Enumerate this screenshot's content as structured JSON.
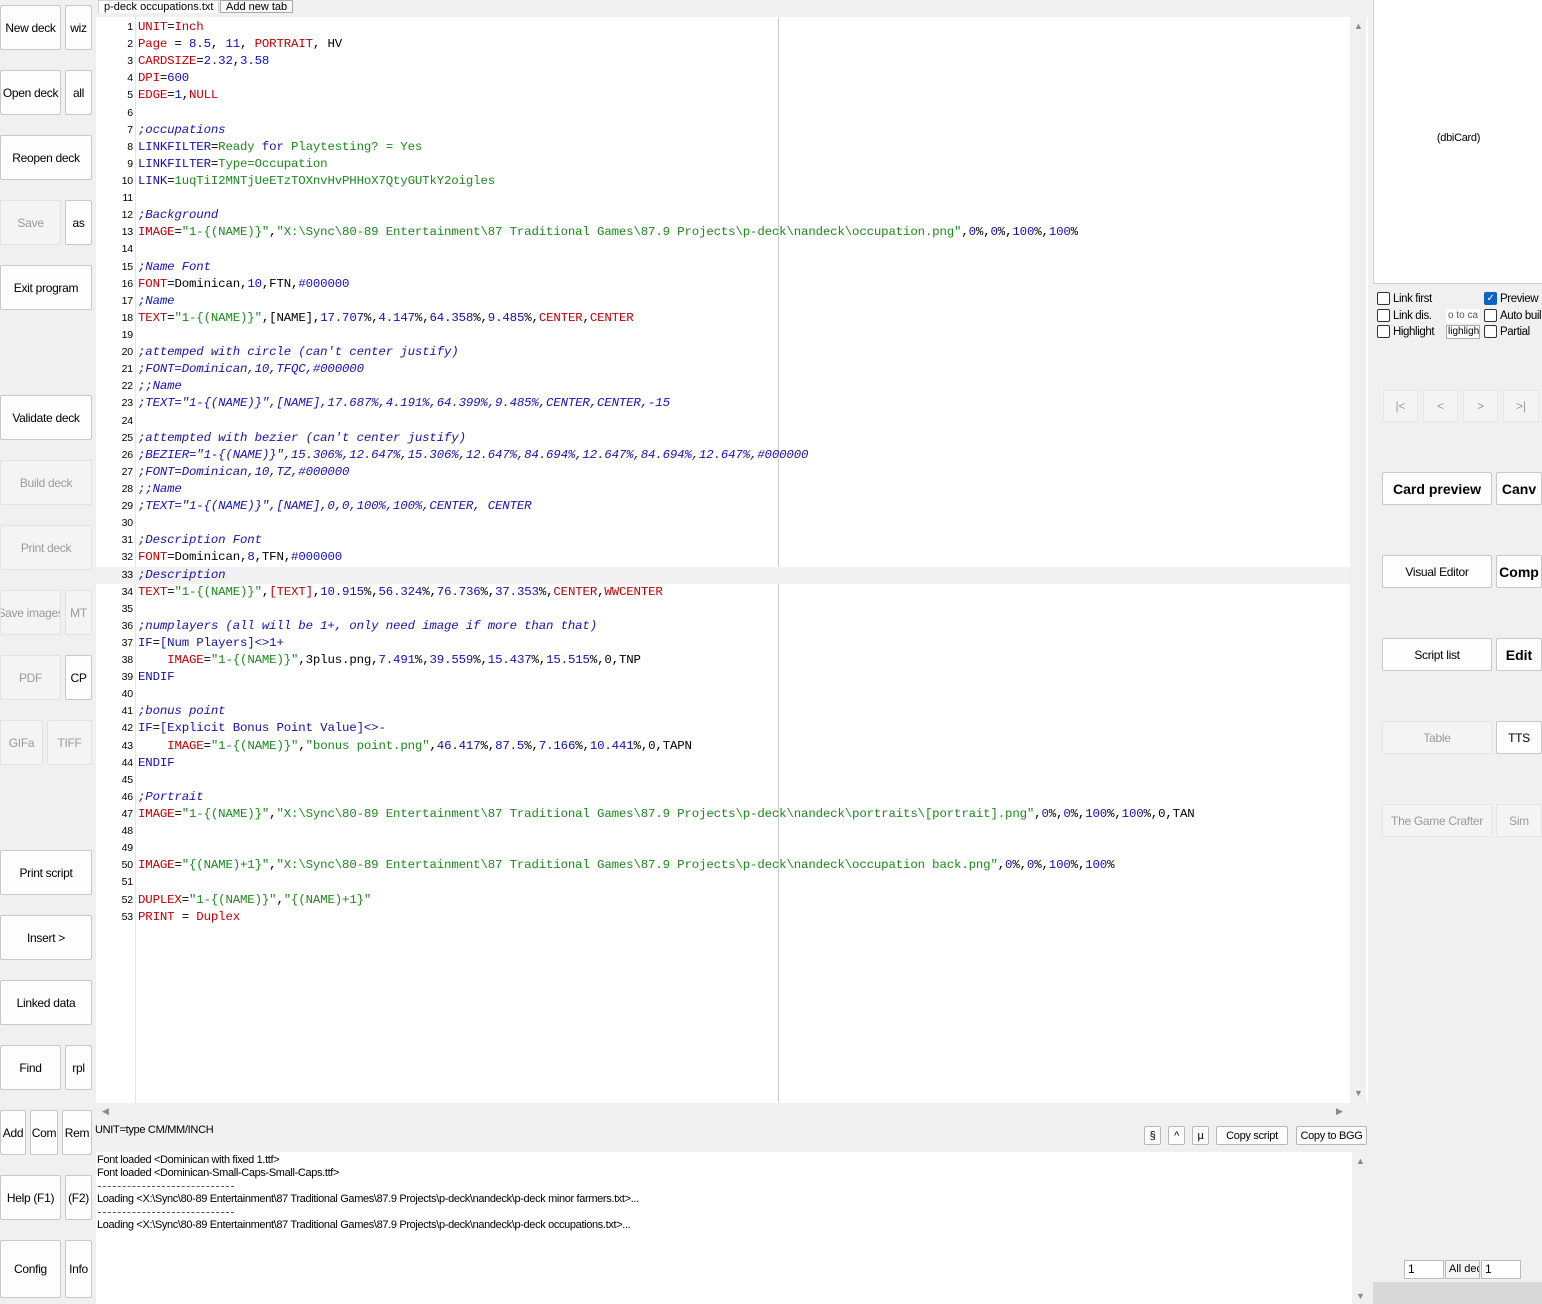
{
  "left_buttons": {
    "new_deck": "New deck",
    "wiz": "wiz",
    "open_deck": "Open deck",
    "all": "all",
    "reopen_deck": "Reopen deck",
    "save": "Save",
    "as": "as",
    "exit_program": "Exit program",
    "validate_deck": "Validate deck",
    "build_deck": "Build deck",
    "print_deck": "Print deck",
    "save_images": "Save images",
    "mt": "MT",
    "pdf": "PDF",
    "cp": "CP",
    "gifa": "GIFa",
    "tiff": "TIFF",
    "print_script": "Print script",
    "insert": "Insert >",
    "linked_data": "Linked data",
    "find": "Find",
    "rpl": "rpl",
    "add": "Add",
    "com": "Com",
    "rem": "Rem",
    "help": "Help (F1)",
    "f2": "(F2)",
    "config": "Config",
    "info": "Info"
  },
  "tabs": {
    "active": "p-deck occupations.txt",
    "add": "Add new tab"
  },
  "editor_lines": [
    [
      [
        "kw",
        "UNIT"
      ],
      [
        "ax",
        "="
      ],
      [
        "kw",
        "Inch"
      ]
    ],
    [
      [
        "kw",
        "Page"
      ],
      [
        "ax",
        " = "
      ],
      [
        "nm",
        "8.5"
      ],
      [
        "ax",
        ", "
      ],
      [
        "nm",
        "11"
      ],
      [
        "ax",
        ", "
      ],
      [
        "kw",
        "PORTRAIT"
      ],
      [
        "ax",
        ", HV"
      ]
    ],
    [
      [
        "kw",
        "CARDSIZE"
      ],
      [
        "ax",
        "="
      ],
      [
        "nm",
        "2.32"
      ],
      [
        "ax",
        ","
      ],
      [
        "nm",
        "3.58"
      ]
    ],
    [
      [
        "kw",
        "DPI"
      ],
      [
        "ax",
        "="
      ],
      [
        "nm",
        "600"
      ]
    ],
    [
      [
        "kw",
        "EDGE"
      ],
      [
        "ax",
        "="
      ],
      [
        "nm",
        "1"
      ],
      [
        "ax",
        ","
      ],
      [
        "kw",
        "NULL"
      ]
    ],
    [],
    [
      [
        "cm",
        ";occupations"
      ]
    ],
    [
      [
        "cd",
        "LINKFILTER"
      ],
      [
        "ax",
        "="
      ],
      [
        "st",
        "Ready "
      ],
      [
        "cd",
        "for"
      ],
      [
        "st",
        " Playtesting? = Yes"
      ]
    ],
    [
      [
        "cd",
        "LINKFILTER"
      ],
      [
        "ax",
        "="
      ],
      [
        "st",
        "Type=Occupation"
      ]
    ],
    [
      [
        "cd",
        "LINK"
      ],
      [
        "ax",
        "="
      ],
      [
        "st",
        "1uqTiI2MNTjUeETzTOXnvHvPHHoX7QtyGUTkY2oigles"
      ]
    ],
    [],
    [
      [
        "cm",
        ";Background"
      ]
    ],
    [
      [
        "kw",
        "IMAGE"
      ],
      [
        "ax",
        "="
      ],
      [
        "st",
        "\"1-{(NAME)}\""
      ],
      [
        "ax",
        ","
      ],
      [
        "st",
        "\"X:\\Sync\\80-89 Entertainment\\87 Traditional Games\\87.9 Projects\\p-deck\\nandeck\\occupation.png\""
      ],
      [
        "ax",
        ","
      ],
      [
        "nm",
        "0"
      ],
      [
        "ax",
        "%,"
      ],
      [
        "nm",
        "0"
      ],
      [
        "ax",
        "%,"
      ],
      [
        "nm",
        "100"
      ],
      [
        "ax",
        "%,"
      ],
      [
        "nm",
        "100"
      ],
      [
        "ax",
        "%"
      ]
    ],
    [],
    [
      [
        "cm",
        ";Name Font"
      ]
    ],
    [
      [
        "kw",
        "FONT"
      ],
      [
        "ax",
        "=Dominican,"
      ],
      [
        "nm",
        "10"
      ],
      [
        "ax",
        ",FTN,"
      ],
      [
        "nm",
        "#000000"
      ]
    ],
    [
      [
        "cm",
        ";Name"
      ]
    ],
    [
      [
        "kw",
        "TEXT"
      ],
      [
        "ax",
        "="
      ],
      [
        "st",
        "\"1-{(NAME)}\""
      ],
      [
        "ax",
        ",[NAME],"
      ],
      [
        "nm",
        "17.707"
      ],
      [
        "ax",
        "%,"
      ],
      [
        "nm",
        "4.147"
      ],
      [
        "ax",
        "%,"
      ],
      [
        "nm",
        "64.358"
      ],
      [
        "ax",
        "%,"
      ],
      [
        "nm",
        "9.485"
      ],
      [
        "ax",
        "%,"
      ],
      [
        "kw",
        "CENTER"
      ],
      [
        "ax",
        ","
      ],
      [
        "kw",
        "CENTER"
      ]
    ],
    [],
    [
      [
        "cm",
        ";attemped with circle (can't center justify)"
      ]
    ],
    [
      [
        "cm",
        ";FONT=Dominican,10,TFQC,#000000"
      ]
    ],
    [
      [
        "cm",
        ";;Name"
      ]
    ],
    [
      [
        "cm",
        ";TEXT=\"1-{(NAME)}\",[NAME],17.687%,4.191%,64.399%,9.485%,CENTER,CENTER,-15"
      ]
    ],
    [],
    [
      [
        "cm",
        ";attempted with bezier (can't center justify)"
      ]
    ],
    [
      [
        "cm",
        ";BEZIER=\"1-{(NAME)}\",15.306%,12.647%,15.306%,12.647%,84.694%,12.647%,84.694%,12.647%,#000000"
      ]
    ],
    [
      [
        "cm",
        ";FONT=Dominican,10,TZ,#000000"
      ]
    ],
    [
      [
        "cm",
        ";;Name"
      ]
    ],
    [
      [
        "cm",
        ";TEXT=\"1-{(NAME)}\",[NAME],0,0,100%,100%,CENTER, CENTER"
      ]
    ],
    [],
    [
      [
        "cm",
        ";Description Font"
      ]
    ],
    [
      [
        "kw",
        "FONT"
      ],
      [
        "ax",
        "=Dominican,"
      ],
      [
        "nm",
        "8"
      ],
      [
        "ax",
        ",TFN,"
      ],
      [
        "nm",
        "#000000"
      ]
    ],
    [
      [
        "cm",
        ";Description"
      ]
    ],
    [
      [
        "kw",
        "TEXT"
      ],
      [
        "ax",
        "="
      ],
      [
        "st",
        "\"1-{(NAME)}\""
      ],
      [
        "ax",
        ","
      ],
      [
        "kw",
        "[TEXT]"
      ],
      [
        "ax",
        ","
      ],
      [
        "nm",
        "10.915"
      ],
      [
        "ax",
        "%,"
      ],
      [
        "nm",
        "56.324"
      ],
      [
        "ax",
        "%,"
      ],
      [
        "nm",
        "76.736"
      ],
      [
        "ax",
        "%,"
      ],
      [
        "nm",
        "37.353"
      ],
      [
        "ax",
        "%,"
      ],
      [
        "kw",
        "CENTER"
      ],
      [
        "ax",
        ","
      ],
      [
        "kw",
        "WWCENTER"
      ]
    ],
    [],
    [
      [
        "cm",
        ";numplayers (all will be 1+, only need image if more than that)"
      ]
    ],
    [
      [
        "cd",
        "IF"
      ],
      [
        "ax",
        "="
      ],
      [
        "cd",
        "[Num Players]<>1+"
      ]
    ],
    [
      [
        "ax",
        "    "
      ],
      [
        "kw",
        "IMAGE"
      ],
      [
        "ax",
        "="
      ],
      [
        "st",
        "\"1-{(NAME)}\""
      ],
      [
        "ax",
        ",3plus.png,"
      ],
      [
        "nm",
        "7.491"
      ],
      [
        "ax",
        "%,"
      ],
      [
        "nm",
        "39.559"
      ],
      [
        "ax",
        "%,"
      ],
      [
        "nm",
        "15.437"
      ],
      [
        "ax",
        "%,"
      ],
      [
        "nm",
        "15.515"
      ],
      [
        "ax",
        "%,0,TNP"
      ]
    ],
    [
      [
        "cd",
        "ENDIF"
      ]
    ],
    [],
    [
      [
        "cm",
        ";bonus point"
      ]
    ],
    [
      [
        "cd",
        "IF"
      ],
      [
        "ax",
        "="
      ],
      [
        "cd",
        "[Explicit Bonus Point Value]<>-"
      ]
    ],
    [
      [
        "ax",
        "    "
      ],
      [
        "kw",
        "IMAGE"
      ],
      [
        "ax",
        "="
      ],
      [
        "st",
        "\"1-{(NAME)}\""
      ],
      [
        "ax",
        ","
      ],
      [
        "st",
        "\"bonus point.png\""
      ],
      [
        "ax",
        ","
      ],
      [
        "nm",
        "46.417"
      ],
      [
        "ax",
        "%,"
      ],
      [
        "nm",
        "87.5"
      ],
      [
        "ax",
        "%,"
      ],
      [
        "nm",
        "7.166"
      ],
      [
        "ax",
        "%,"
      ],
      [
        "nm",
        "10.441"
      ],
      [
        "ax",
        "%,0,TAPN"
      ]
    ],
    [
      [
        "cd",
        "ENDIF"
      ]
    ],
    [],
    [
      [
        "cm",
        ";Portrait"
      ]
    ],
    [
      [
        "kw",
        "IMAGE"
      ],
      [
        "ax",
        "="
      ],
      [
        "st",
        "\"1-{(NAME)}\""
      ],
      [
        "ax",
        ","
      ],
      [
        "st",
        "\"X:\\Sync\\80-89 Entertainment\\87 Traditional Games\\87.9 Projects\\p-deck\\nandeck\\portraits\\[portrait].png\""
      ],
      [
        "ax",
        ","
      ],
      [
        "nm",
        "0"
      ],
      [
        "ax",
        "%,"
      ],
      [
        "nm",
        "0"
      ],
      [
        "ax",
        "%,"
      ],
      [
        "nm",
        "100"
      ],
      [
        "ax",
        "%,"
      ],
      [
        "nm",
        "100"
      ],
      [
        "ax",
        "%,0,TAN"
      ]
    ],
    [],
    [],
    [
      [
        "kw",
        "IMAGE"
      ],
      [
        "ax",
        "="
      ],
      [
        "st",
        "\"{(NAME)+1}\""
      ],
      [
        "ax",
        ","
      ],
      [
        "st",
        "\"X:\\Sync\\80-89 Entertainment\\87 Traditional Games\\87.9 Projects\\p-deck\\nandeck\\occupation back.png\""
      ],
      [
        "ax",
        ","
      ],
      [
        "nm",
        "0"
      ],
      [
        "ax",
        "%,"
      ],
      [
        "nm",
        "0"
      ],
      [
        "ax",
        "%,"
      ],
      [
        "nm",
        "100"
      ],
      [
        "ax",
        "%,"
      ],
      [
        "nm",
        "100"
      ],
      [
        "ax",
        "%"
      ]
    ],
    [],
    [
      [
        "kw",
        "DUPLEX"
      ],
      [
        "ax",
        "="
      ],
      [
        "st",
        "\"1-{(NAME)}\""
      ],
      [
        "ax",
        ","
      ],
      [
        "st",
        "\"{(NAME)+1}\""
      ]
    ],
    [
      [
        "kw",
        "PRINT"
      ],
      [
        "ax",
        " = "
      ],
      [
        "kw",
        "Duplex"
      ]
    ]
  ],
  "current_line": 33,
  "status": {
    "hint": "UNIT=type CM/MM/INCH",
    "section": "§",
    "caret": "^",
    "mu": "µ",
    "copy_script": "Copy script",
    "copy_bgg": "Copy to BGG"
  },
  "log": {
    "l1": "Font loaded <Dominican with fixed 1.ttf>",
    "l2": "Font loaded <Dominican-Small-Caps-Small-Caps.ttf>",
    "l3": "Loading <X:\\Sync\\80-89 Entertainment\\87 Traditional Games\\87.9 Projects\\p-deck\\nandeck\\p-deck minor farmers.txt>...",
    "l4": "Loading <X:\\Sync\\80-89 Entertainment\\87 Traditional Games\\87.9 Projects\\p-deck\\nandeck\\p-deck occupations.txt>..."
  },
  "preview": {
    "label": "(dbiCard)"
  },
  "options": {
    "link_first": "Link first",
    "preview": "Preview",
    "link_dis": "Link dis.",
    "link_dis_field": "o to ca",
    "auto_build": "Auto buil",
    "highlight": "Highlight",
    "highlight_field": "lighligh",
    "partial": "Partial"
  },
  "option_states": {
    "link_first": false,
    "preview": true,
    "link_dis": false,
    "auto_build": false,
    "highlight": false,
    "partial": false
  },
  "nav": {
    "first": "|<",
    "prev": "<",
    "next": ">",
    "last": ">|"
  },
  "right_buttons": {
    "card_preview": "Card preview",
    "canv": "Canv",
    "visual_editor": "Visual Editor",
    "comp": "Comp",
    "script_list": "Script list",
    "edit": "Edit",
    "table": "Table",
    "tts": "TTS",
    "game_crafter": "The Game Crafter",
    "sim": "Sim"
  },
  "paging": {
    "from": "1",
    "all_decks": "All deck",
    "to": "1"
  }
}
